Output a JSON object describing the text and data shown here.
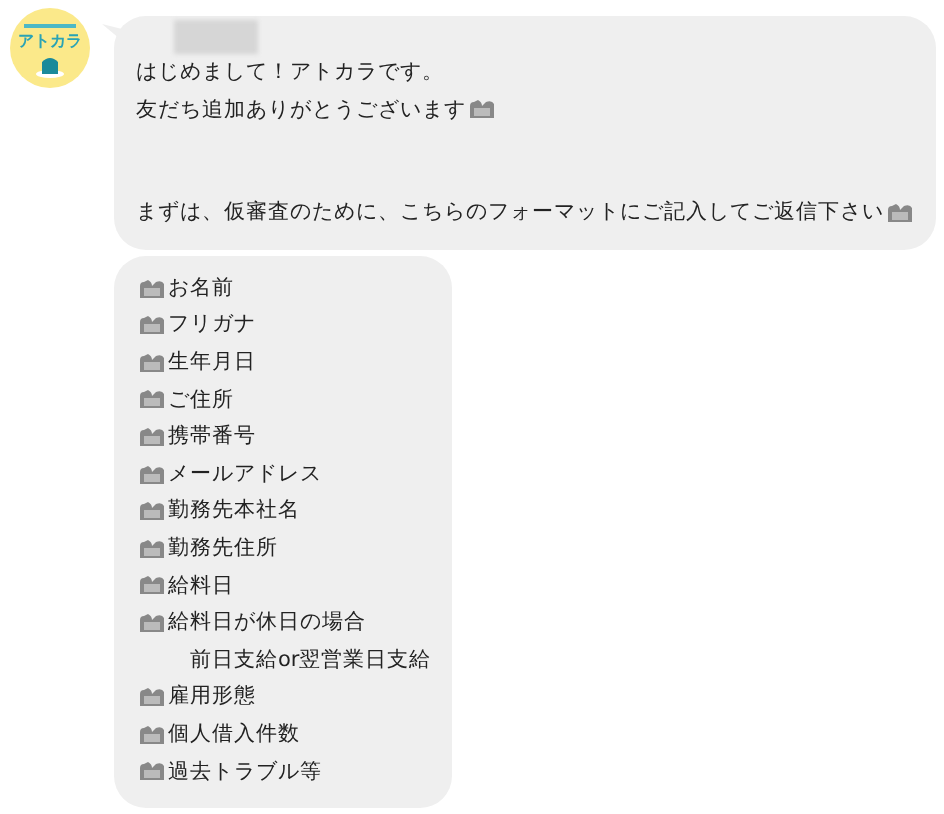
{
  "sender": {
    "logo_text": "アトカラ"
  },
  "messages": [
    {
      "kind": "greeting",
      "paragraphs": [
        [
          {
            "text": "はじめまして！アトカラです。",
            "emoji_after": false
          },
          {
            "text": "友だち追加ありがとうございます",
            "emoji_after": true
          }
        ],
        [
          {
            "text": "まずは、仮審査のために、こちらのフォーマットにご記入してご返信下さい",
            "emoji_after": true
          }
        ]
      ]
    },
    {
      "kind": "form",
      "items": [
        {
          "kind": "item",
          "text": "お名前"
        },
        {
          "kind": "item",
          "text": "フリガナ"
        },
        {
          "kind": "item",
          "text": "生年月日"
        },
        {
          "kind": "item",
          "text": "ご住所"
        },
        {
          "kind": "item",
          "text": "携帯番号"
        },
        {
          "kind": "item",
          "text": "メールアドレス"
        },
        {
          "kind": "item",
          "text": "勤務先本社名"
        },
        {
          "kind": "item",
          "text": "勤務先住所"
        },
        {
          "kind": "item",
          "text": "給料日"
        },
        {
          "kind": "item",
          "text": "給料日が休日の場合"
        },
        {
          "kind": "continuation",
          "text": "前日支給or翌営業日支給"
        },
        {
          "kind": "item",
          "text": "雇用形態"
        },
        {
          "kind": "item",
          "text": "個人借入件数"
        },
        {
          "kind": "item",
          "text": "過去トラブル等"
        }
      ]
    }
  ]
}
